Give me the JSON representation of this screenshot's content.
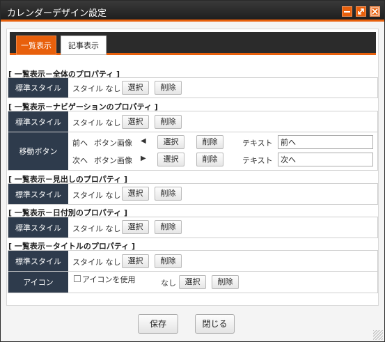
{
  "window": {
    "title": "カレンダーデザイン設定"
  },
  "tabs": [
    {
      "label": "一覧表示"
    },
    {
      "label": "記事表示"
    }
  ],
  "sections": {
    "all": "[ 一覧表示－全体のプロパティ ]",
    "nav": "[ 一覧表示－ナビゲーションのプロパティ ]",
    "heading": "[ 一覧表示－見出しのプロパティ ]",
    "date": "[ 一覧表示－日付別のプロパティ ]",
    "title": "[ 一覧表示－タイトルのプロパティ ]"
  },
  "labels": {
    "standard_style": "標準スタイル",
    "move_button": "移動ボタン",
    "icon": "アイコン"
  },
  "values": {
    "style_none": "スタイル なし",
    "prev": "前へ",
    "next": "次へ",
    "button_image": "ボタン画像",
    "prev_arrow": "◀",
    "next_arrow": "▶",
    "text_label": "テキスト",
    "prev_text": "前へ",
    "next_text": "次へ",
    "use_icon": "アイコンを使用",
    "none": "なし"
  },
  "buttons": {
    "select": "選択",
    "delete": "削除",
    "save": "保存",
    "close": "閉じる"
  },
  "colors": {
    "accent": "#e8600c",
    "label_bg": "#2e3b4c",
    "titlebar": "#2b2b2b"
  }
}
